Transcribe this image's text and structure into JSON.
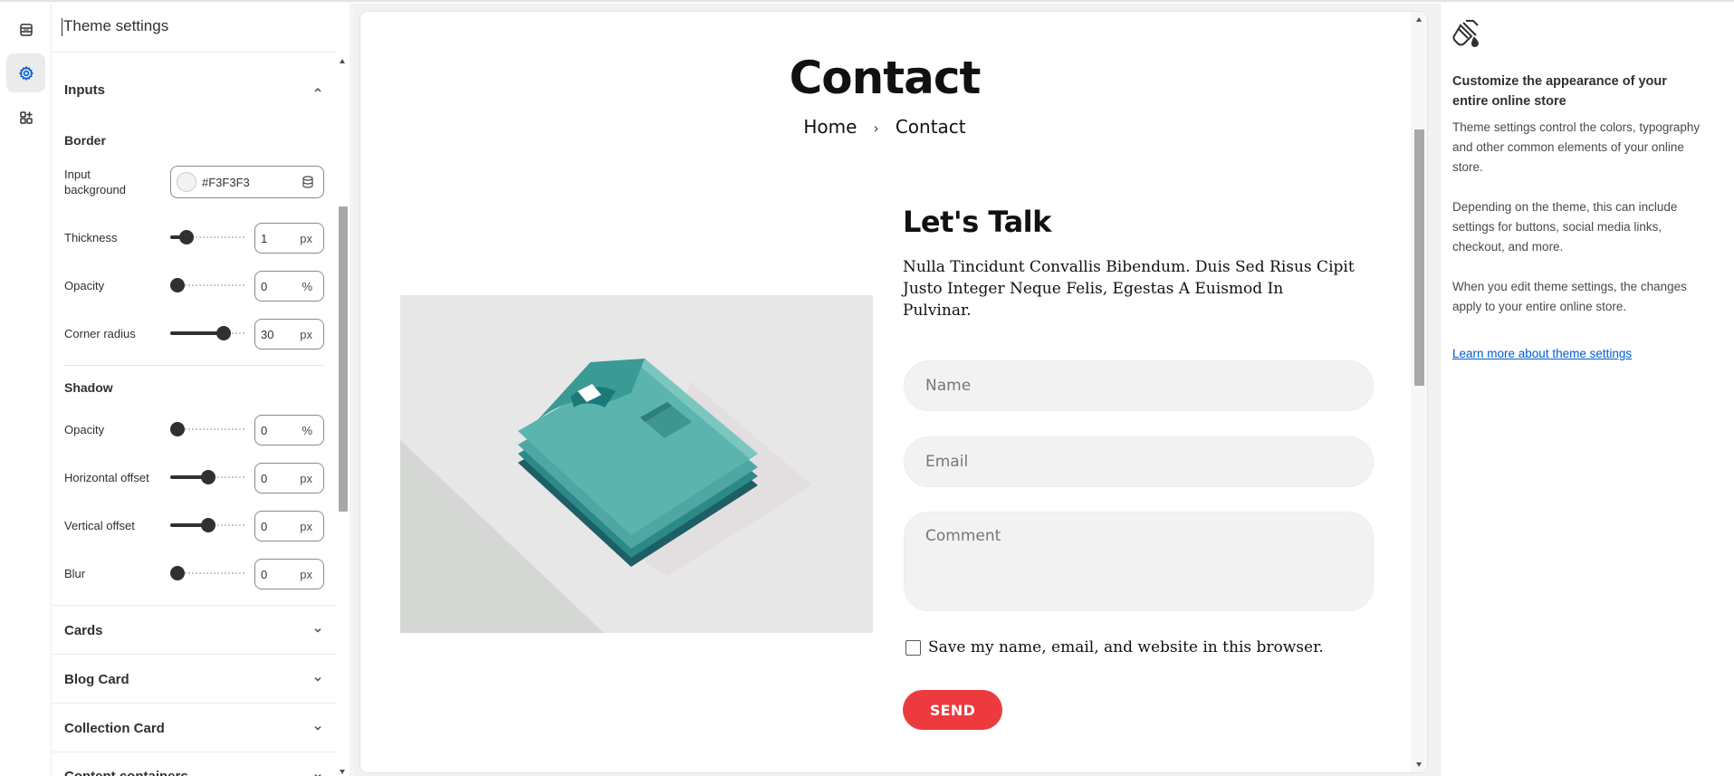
{
  "rail": {
    "items": [
      {
        "icon": "layout-sections-icon"
      },
      {
        "icon": "gear-icon",
        "active": true
      },
      {
        "icon": "apps-icon"
      }
    ]
  },
  "panel": {
    "title": "Theme settings",
    "inputs_section": {
      "title": "Inputs",
      "border_heading": "Border",
      "input_background": {
        "label": "Input background",
        "value": "#F3F3F3",
        "swatch_color": "#F3F3F3"
      },
      "thickness": {
        "label": "Thickness",
        "value": "1",
        "unit": "px",
        "level": 0.14
      },
      "border_opacity": {
        "label": "Opacity",
        "value": "0",
        "unit": "%",
        "level": 0
      },
      "corner_radius": {
        "label": "Corner radius",
        "value": "30",
        "unit": "px",
        "level": 0.75
      },
      "shadow_heading": "Shadow",
      "shadow_opacity": {
        "label": "Opacity",
        "value": "0",
        "unit": "%",
        "level": 0
      },
      "horizontal_offset": {
        "label": "Horizontal offset",
        "value": "0",
        "unit": "px",
        "level": 0.5
      },
      "vertical_offset": {
        "label": "Vertical offset",
        "value": "0",
        "unit": "px",
        "level": 0.5
      },
      "blur": {
        "label": "Blur",
        "value": "0",
        "unit": "px",
        "level": 0
      }
    },
    "collapsed_sections": [
      {
        "title": "Cards"
      },
      {
        "title": "Blog Card"
      },
      {
        "title": "Collection Card"
      },
      {
        "title": "Content containers"
      }
    ]
  },
  "preview": {
    "page_title": "Contact",
    "breadcrumb": {
      "home": "Home",
      "separator": "›",
      "current": "Contact"
    },
    "heading": "Let's Talk",
    "text": "Nulla Tincidunt Convallis Bibendum. Duis Sed Risus Cipit Justo Integer Neque Felis, Egestas A Euismod In Pulvinar.",
    "form": {
      "name_placeholder": "Name",
      "email_placeholder": "Email",
      "comment_placeholder": "Comment",
      "save_label": "Save my name, email, and website in this browser.",
      "send_label": "SEND"
    },
    "colors": {
      "send_button": "#ed3a3f",
      "input_bg": "#F3F3F3"
    }
  },
  "info": {
    "icon": "paint-bucket-icon",
    "heading": "Customize the appearance of your entire online store",
    "paragraph1": "Theme settings control the colors, typography and other common elements of your online store.",
    "paragraph2": "Depending on the theme, this can include settings for buttons, social media links, checkout, and more.",
    "paragraph3": "When you edit theme settings, the changes apply to your entire online store.",
    "link": "Learn more about theme settings"
  }
}
